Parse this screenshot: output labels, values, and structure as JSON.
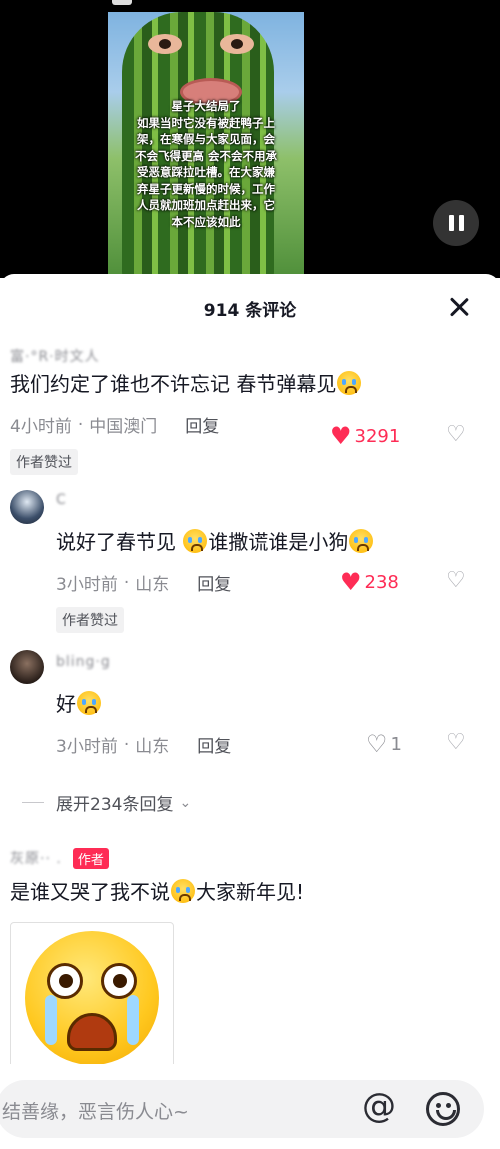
{
  "video": {
    "overlay_lines": [
      "星子大结局了",
      "如果当时它没有被赶鸭子上",
      "架，在寒假与大家见面，会",
      "不会飞得更高 会不会不用承",
      "受恶意踩拉吐槽。在大家嫌",
      "弃星子更新慢的时候，工作",
      "人员就加班加点赶出来，它",
      "本不应该如此"
    ]
  },
  "comments_panel": {
    "title": "914 条评论"
  },
  "comments": [
    {
      "username": "富·°R·时文人",
      "text": "我们约定了谁也不许忘记 春节弹幕见",
      "time": "4小时前",
      "location": "中国澳门",
      "reply": "回复",
      "likes": "3291",
      "badge": "作者赞过"
    },
    {
      "username": "C",
      "text": "说好了春节见 ",
      "text2": "谁撒谎谁是小狗",
      "time": "3小时前",
      "location": "山东",
      "reply": "回复",
      "likes": "238",
      "badge": "作者赞过"
    },
    {
      "username": "bling·g ",
      "text": "好",
      "time": "3小时前",
      "location": "山东",
      "reply": "回复",
      "likes": "1"
    },
    {
      "username": "灰原·· .",
      "author_tag": "作者",
      "text": "是谁又哭了我不说",
      "text2": "大家新年见!"
    }
  ],
  "expand_replies": "展开234条回复",
  "input": {
    "placeholder": "结善缘，恶言伤人心~"
  },
  "icons": {
    "close": "close-icon",
    "pause": "pause-icon",
    "heart": "heart-icon",
    "dislike": "broken-heart-icon",
    "at": "at-icon",
    "emoji": "emoji-icon"
  },
  "colors": {
    "accent": "#fe2c55",
    "text": "#161823",
    "muted": "#8a8b91"
  }
}
